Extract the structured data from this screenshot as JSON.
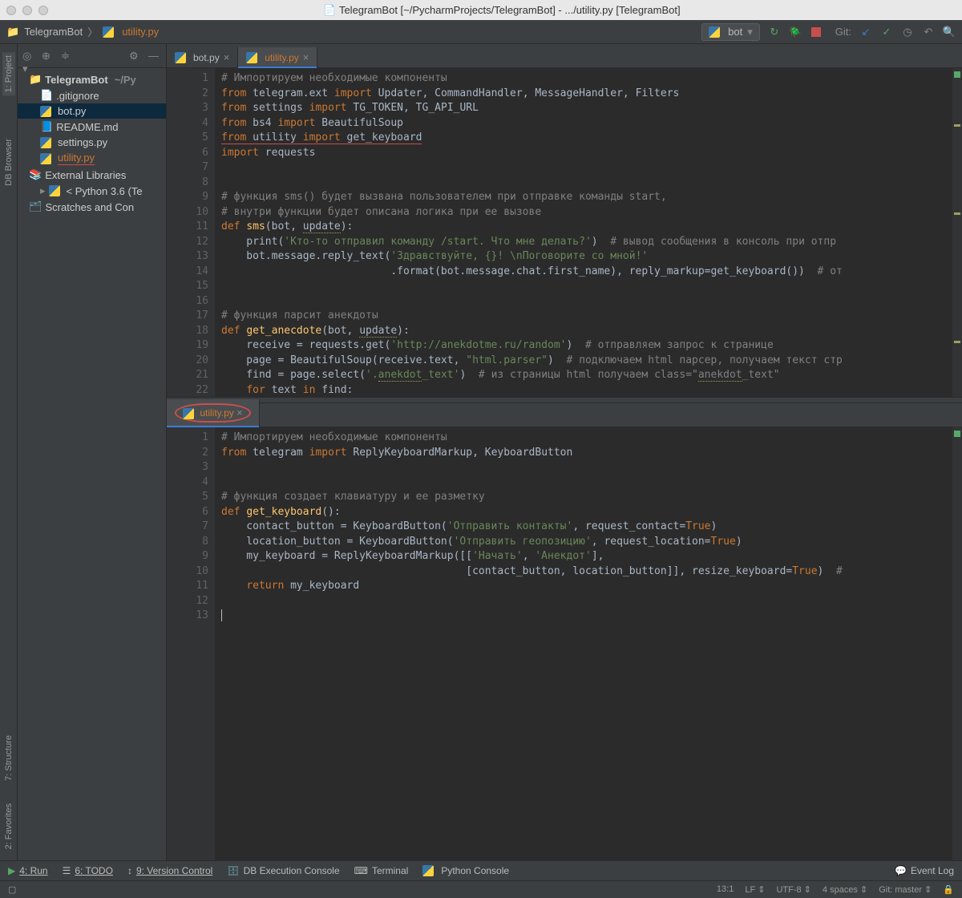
{
  "window": {
    "title": "TelegramBot [~/PycharmProjects/TelegramBot] - .../utility.py [TelegramBot]"
  },
  "breadcrumb": {
    "root": "TelegramBot",
    "file": "utility.py"
  },
  "run_config": {
    "label": "bot"
  },
  "git_label": "Git:",
  "sidebar": {
    "project": "TelegramBot",
    "project_path": "~/Py",
    "files": [
      {
        "name": ".gitignore"
      },
      {
        "name": "bot.py"
      },
      {
        "name": "README.md"
      },
      {
        "name": "settings.py"
      },
      {
        "name": "utility.py"
      }
    ],
    "ext_lib": "External Libraries",
    "python": "< Python 3.6 (Te",
    "scratches": "Scratches and Con"
  },
  "left_tabs": {
    "project": "1: Project",
    "db": "DB Browser",
    "structure": "7: Structure",
    "favorites": "2: Favorites"
  },
  "tabs_top": [
    {
      "name": "bot.py",
      "active": false
    },
    {
      "name": "utility.py",
      "active": true
    }
  ],
  "tabs_bottom_editor": [
    {
      "name": "utility.py",
      "active": true
    }
  ],
  "bottom_bar": {
    "run": "4: Run",
    "todo": "6: TODO",
    "vcs": "9: Version Control",
    "db": "DB Execution Console",
    "terminal": "Terminal",
    "pyconsole": "Python Console",
    "eventlog": "Event Log"
  },
  "status_bar": {
    "pos": "13:1",
    "line_ending": "LF",
    "encoding": "UTF-8",
    "indent": "4 spaces",
    "git": "Git: master"
  }
}
